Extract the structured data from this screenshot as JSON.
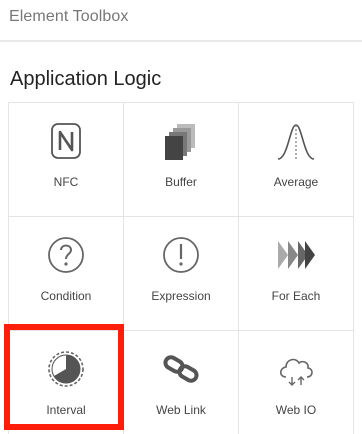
{
  "panel": {
    "title": "Element Toolbox"
  },
  "section": {
    "title": "Application Logic"
  },
  "tiles": [
    {
      "label": "NFC",
      "icon": "nfc-icon"
    },
    {
      "label": "Buffer",
      "icon": "buffer-icon"
    },
    {
      "label": "Average",
      "icon": "average-icon"
    },
    {
      "label": "Condition",
      "icon": "condition-icon"
    },
    {
      "label": "Expression",
      "icon": "expression-icon"
    },
    {
      "label": "For Each",
      "icon": "for-each-icon"
    },
    {
      "label": "Interval",
      "icon": "interval-icon"
    },
    {
      "label": "Web Link",
      "icon": "web-link-icon"
    },
    {
      "label": "Web IO",
      "icon": "web-io-icon"
    }
  ],
  "selected_tile": "Interval",
  "colors": {
    "highlight": "#ff1e0a",
    "icon": "#555555",
    "border": "#e4e4e4"
  }
}
